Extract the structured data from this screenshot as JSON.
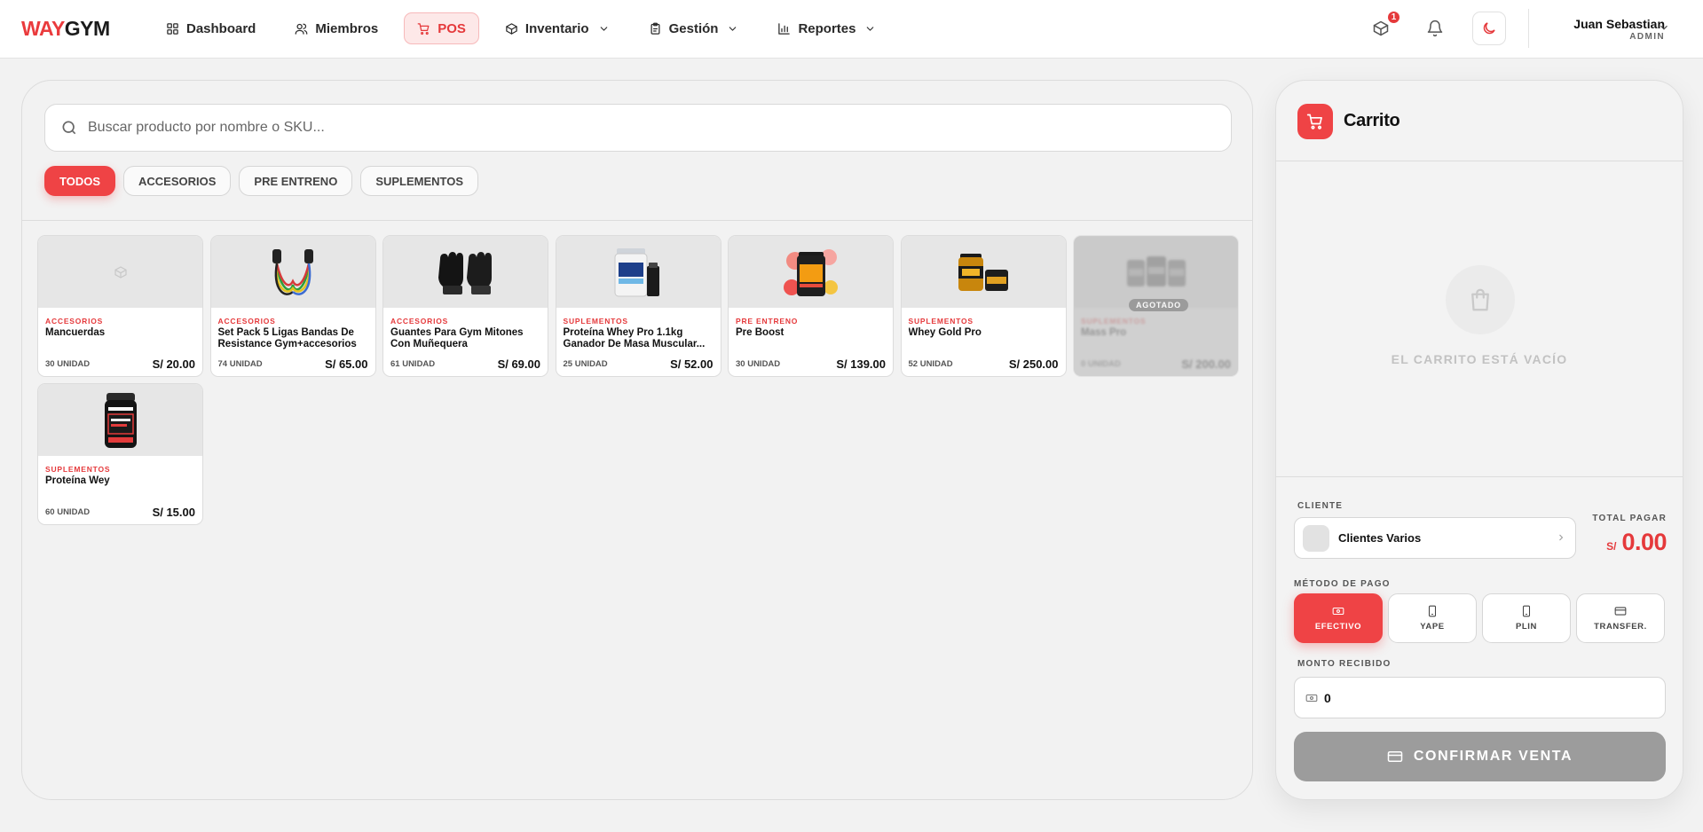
{
  "brand": {
    "part1": "WAY",
    "part2": "GYM",
    "accent_color": "#ea3b3d"
  },
  "nav": {
    "items": [
      {
        "label": "Dashboard",
        "icon": "grid-icon",
        "active": false
      },
      {
        "label": "Miembros",
        "icon": "users-icon",
        "active": false
      },
      {
        "label": "POS",
        "icon": "cart-icon",
        "active": true
      },
      {
        "label": "Inventario",
        "icon": "box-icon",
        "active": false,
        "dropdown": true
      },
      {
        "label": "Gestión",
        "icon": "clipboard-icon",
        "active": false,
        "dropdown": true
      },
      {
        "label": "Reportes",
        "icon": "bar-chart-icon",
        "active": false,
        "dropdown": true
      }
    ]
  },
  "header": {
    "notification_count": "1",
    "user_name": "Juan Sebastian",
    "user_role": "ADMIN"
  },
  "search": {
    "placeholder": "Buscar producto por nombre o SKU..."
  },
  "filters": [
    "TODOS",
    "ACCESORIOS",
    "PRE ENTRENO",
    "SUPLEMENTOS"
  ],
  "active_filter": "TODOS",
  "products": [
    {
      "category": "ACCESORIOS",
      "name": "Mancuerdas",
      "stock": "30 UNIDAD",
      "price": "S/ 20.00",
      "image": "placeholder-box-icon",
      "out_of_stock": false
    },
    {
      "category": "ACCESORIOS",
      "name": "Set Pack 5 Ligas Bandas De Resistance Gym+accesorios +...",
      "stock": "74 UNIDAD",
      "price": "S/ 65.00",
      "image": "resistance-bands-image",
      "out_of_stock": false
    },
    {
      "category": "ACCESORIOS",
      "name": "Guantes Para Gym Mitones Con Muñequera",
      "stock": "61 UNIDAD",
      "price": "S/ 69.00",
      "image": "gloves-image",
      "out_of_stock": false
    },
    {
      "category": "SUPLEMENTOS",
      "name": "Proteína Whey Pro 1.1kg Ganador De Masa Muscular...",
      "stock": "25 UNIDAD",
      "price": "S/ 52.00",
      "image": "whey-pro-image",
      "out_of_stock": false
    },
    {
      "category": "PRE ENTRENO",
      "name": "Pre Boost",
      "stock": "30 UNIDAD",
      "price": "S/ 139.00",
      "image": "pre-boost-image",
      "out_of_stock": false
    },
    {
      "category": "SUPLEMENTOS",
      "name": "Whey Gold Pro",
      "stock": "52 UNIDAD",
      "price": "S/ 250.00",
      "image": "whey-gold-image",
      "out_of_stock": false
    },
    {
      "category": "SUPLEMENTOS",
      "name": "Mass Pro",
      "stock": "0 UNIDAD",
      "price": "S/ 200.00",
      "image": "mass-pro-image",
      "out_of_stock": true,
      "badge": "AGOTADO"
    },
    {
      "category": "SUPLEMENTOS",
      "name": "Proteína Wey",
      "stock": "60 UNIDAD",
      "price": "S/ 15.00",
      "image": "protein-tub-image",
      "out_of_stock": false
    }
  ],
  "cart": {
    "title": "Carrito",
    "empty_message": "EL CARRITO ESTÁ VACÍO",
    "client_label": "CLIENTE",
    "client_value": "Clientes Varios",
    "total_label": "TOTAL PAGAR",
    "total_currency": "S/",
    "total_amount": "0.00",
    "payment_label": "MÉTODO DE PAGO",
    "payment_methods": [
      {
        "label": "EFECTIVO",
        "icon": "cash-icon",
        "active": true
      },
      {
        "label": "YAPE",
        "icon": "phone-icon",
        "active": false
      },
      {
        "label": "PLIN",
        "icon": "phone-icon",
        "active": false
      },
      {
        "label": "TRANSFER.",
        "icon": "card-icon",
        "active": false
      }
    ],
    "amount_label": "MONTO RECIBIDO",
    "amount_value": "0",
    "confirm_label": "CONFIRMAR VENTA"
  }
}
